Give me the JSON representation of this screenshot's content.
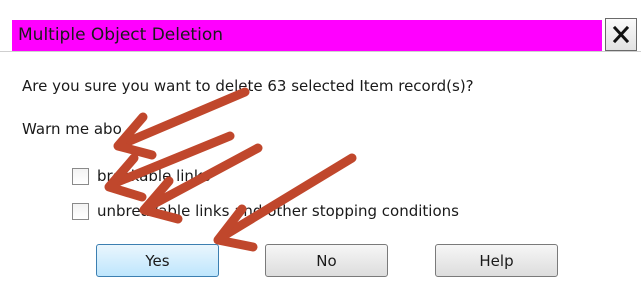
{
  "window": {
    "title": "Multiple Object Deletion",
    "title_color": "#ff00ff",
    "close_icon": "close-icon"
  },
  "message": {
    "question": "Are you sure you want to delete 63 selected Item record(s)?",
    "warn_label": "Warn me abo"
  },
  "options": [
    {
      "label": "breakable links",
      "checked": false
    },
    {
      "label": "unbreakable links and other stopping conditions",
      "checked": false
    }
  ],
  "buttons": {
    "yes": "Yes",
    "no": "No",
    "help": "Help"
  },
  "annotation": {
    "arrow_color": "#c0472c",
    "arrow_count": 4
  }
}
